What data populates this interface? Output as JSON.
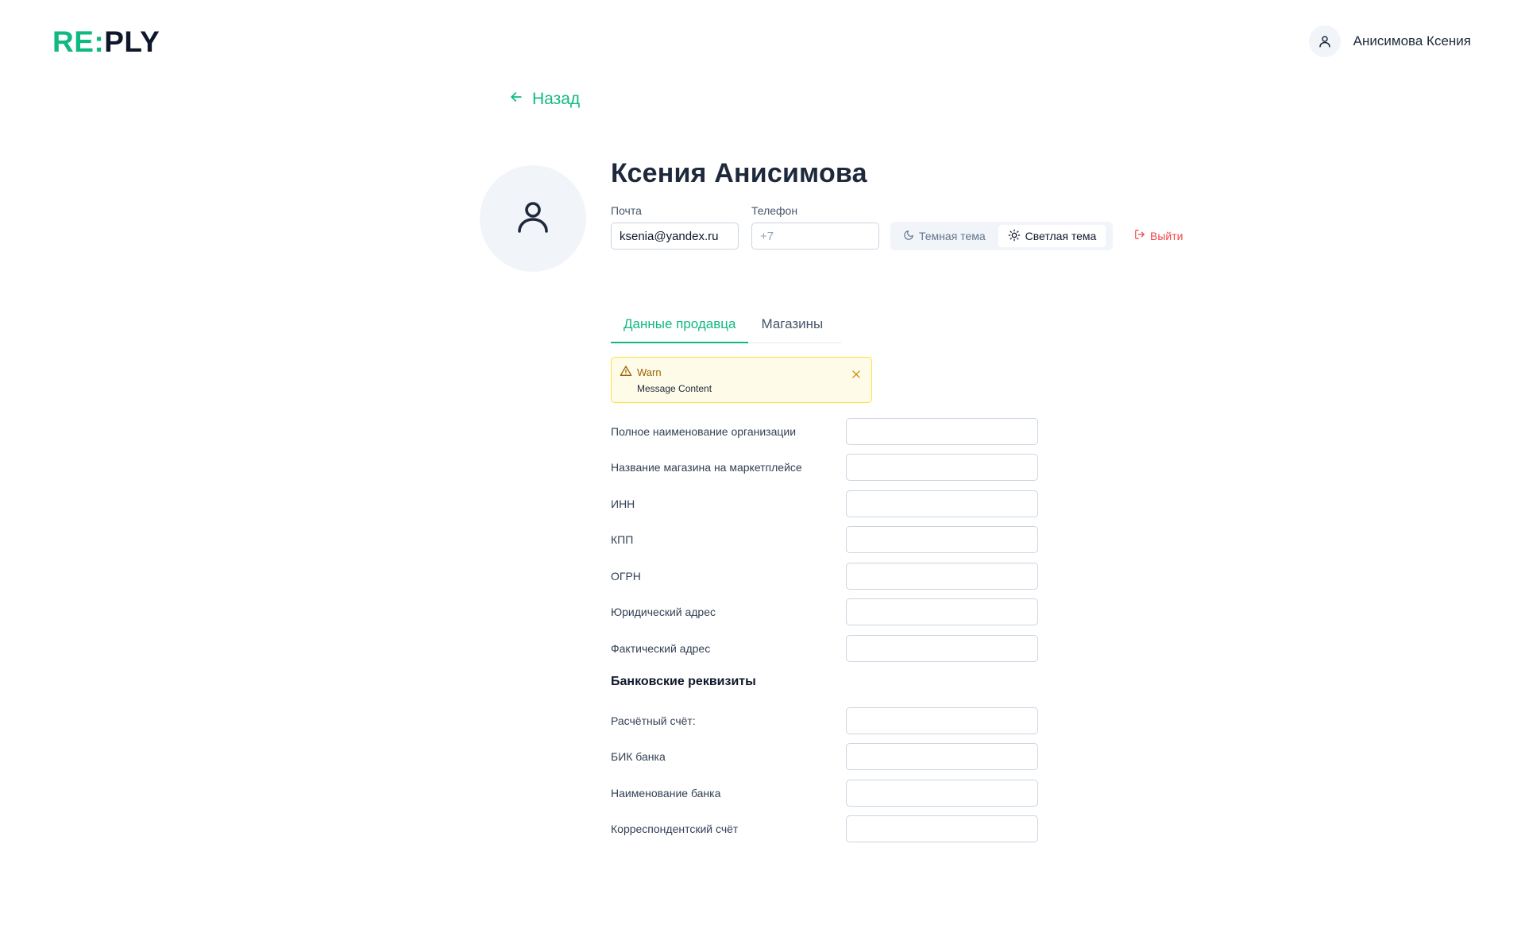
{
  "header": {
    "logo_left": "RE:",
    "logo_right": "PLY",
    "user_name": "Анисимова Ксения",
    "avatar_icon": "user-icon"
  },
  "back": {
    "label": "Назад",
    "icon": "arrow-left-icon"
  },
  "profile": {
    "name": "Ксения Анисимова",
    "avatar_icon": "user-icon",
    "email_label": "Почта",
    "email_value": "ksenia@yandex.ru",
    "phone_label": "Телефон",
    "phone_placeholder": "+7"
  },
  "theme": {
    "dark_label": "Темная тема",
    "light_label": "Светлая тема",
    "selected": "light"
  },
  "logout": {
    "label": "Выйти",
    "icon": "logout-icon"
  },
  "tabs": [
    {
      "label": "Данные продавца",
      "active": true
    },
    {
      "label": "Магазины",
      "active": false
    }
  ],
  "warn": {
    "title": "Warn",
    "message": "Message Content"
  },
  "form": {
    "fields": [
      {
        "label": "Полное наименование организации",
        "value": ""
      },
      {
        "label": "Название магазина на маркетплейсе",
        "value": ""
      },
      {
        "label": "ИНН",
        "value": ""
      },
      {
        "label": "КПП",
        "value": ""
      },
      {
        "label": "ОГРН",
        "value": ""
      },
      {
        "label": "Юридический адрес",
        "value": ""
      },
      {
        "label": "Фактический адрес",
        "value": ""
      }
    ],
    "bank_section_title": "Банковские реквизиты",
    "bank_fields": [
      {
        "label": "Расчётный счёт:",
        "value": ""
      },
      {
        "label": "БИК банка",
        "value": ""
      },
      {
        "label": "Наименование банка",
        "value": ""
      },
      {
        "label": "Корреспондентский счёт",
        "value": ""
      }
    ]
  },
  "colors": {
    "accent": "#10b981",
    "danger": "#ef4444",
    "warn_bg": "#fefce8",
    "warn_border": "#fde047",
    "warn_text": "#a16207"
  }
}
